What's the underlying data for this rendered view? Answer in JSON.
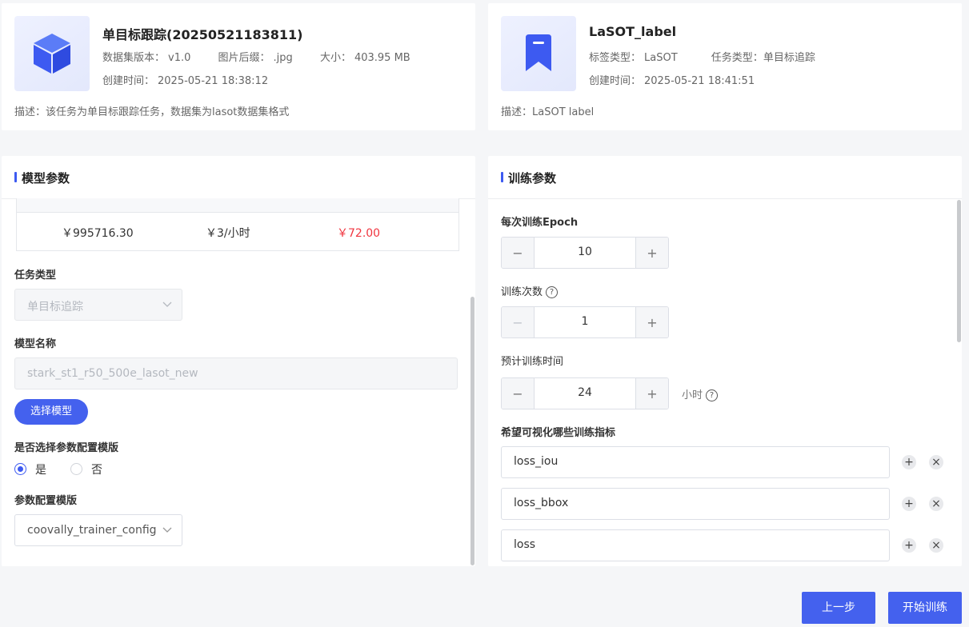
{
  "dataset": {
    "icon": "cube-icon",
    "title": "单目标跟踪(20250521183811)",
    "version_label": "数据集版本：",
    "version_value": "v1.0",
    "suffix_label": "图片后缀：",
    "suffix_value": ".jpg",
    "size_label": "大小：",
    "size_value": "403.95 MB",
    "created_label": "创建时间：",
    "created_value": "2025-05-21 18:38:12",
    "description": "描述：该任务为单目标跟踪任务，数据集为lasot数据集格式"
  },
  "label_set": {
    "icon": "bookmark-icon",
    "title": "LaSOT_label",
    "type_label": "标签类型：",
    "type_value": "LaSOT",
    "task_label": "任务类型：",
    "task_value": "单目标追踪",
    "created_label": "创建时间：",
    "created_value": "2025-05-21 18:41:51",
    "description": "描述：LaSOT label"
  },
  "model_panel": {
    "title": "模型参数",
    "price_row": {
      "balance": "￥995716.30",
      "rate": "￥3/小时",
      "cost": "￥72.00"
    },
    "task_type_label": "任务类型",
    "task_type_value": "单目标追踪",
    "model_name_label": "模型名称",
    "model_name_placeholder": "stark_st1_r50_500e_lasot_new",
    "select_model_button": "选择模型",
    "use_template_label": "是否选择参数配置模版",
    "radio_yes": "是",
    "radio_no": "否",
    "template_label": "参数配置模版",
    "template_value": "coovally_trainer_config"
  },
  "train_panel": {
    "title": "训练参数",
    "epoch_label": "每次训练Epoch",
    "epoch_value": "10",
    "train_times_label": "训练次数",
    "train_times_value": "1",
    "est_time_label": "预计训练时间",
    "est_time_value": "24",
    "est_time_unit": "小时",
    "metrics_label": "希望可视化哪些训练指标",
    "metrics": [
      "loss_iou",
      "loss_bbox",
      "loss"
    ]
  },
  "footer": {
    "prev_button": "上一步",
    "start_button": "开始训练"
  },
  "colors": {
    "primary": "#4461ee",
    "price_red": "#f0353f"
  }
}
